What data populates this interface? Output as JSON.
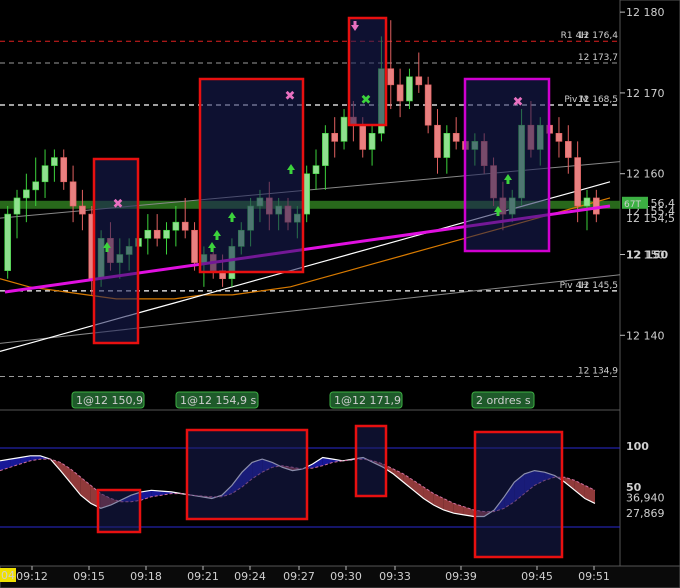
{
  "chart_data": [
    {
      "type": "candlestick",
      "price_axis": {
        "ticks": [
          "12 180",
          "12 170",
          "12 160",
          "12 150",
          "12 140"
        ],
        "range": [
          12131,
          12181.5
        ]
      },
      "time_axis": {
        "ticks": [
          "04",
          "09:12",
          "09:15",
          "09:18",
          "09:21",
          "09:24",
          "09:27",
          "09:30",
          "09:33",
          "09:39",
          "09:45",
          "09:51"
        ],
        "start_label": "04"
      },
      "levels": [
        {
          "name": "R1 4H",
          "label": "R1 4H",
          "value_label": "12 176,4",
          "value": 12176.4,
          "color": "#e02020",
          "style": "dashed"
        },
        {
          "name": "",
          "label": "",
          "value_label": "12 173,7",
          "value": 12173.7,
          "color": "#9a9a9a",
          "style": "dashed"
        },
        {
          "name": "Piv M",
          "label": "Piv M",
          "value_label": "12 168,5",
          "value": 12168.5,
          "color": "#ffffff",
          "style": "dashed"
        },
        {
          "name": "Piv 4H",
          "label": "Piv 4H",
          "value_label": "12 145,5",
          "value": 12145.5,
          "color": "#ffffff",
          "style": "dashed"
        },
        {
          "name": "",
          "label": "",
          "value_label": "12 134,9",
          "value": 12134.9,
          "color": "#9a9a9a",
          "style": "dashed"
        }
      ],
      "price_badges": [
        {
          "text": "12 156,4",
          "value": 12156.4,
          "color": "#3cb043"
        },
        {
          "text": "12 155,4",
          "value": 12155.4,
          "color": "#e05555"
        },
        {
          "text": "12 154,5",
          "value": 12154.5,
          "color": "#ffffff"
        },
        {
          "text": "12 150",
          "value": 12150.0,
          "color": "#ffffff"
        }
      ],
      "current_badge": "67T",
      "candles": [
        [
          12148,
          12156,
          12147,
          12155
        ],
        [
          12155,
          12158,
          12152,
          12157
        ],
        [
          12157,
          12160,
          12154,
          12158
        ],
        [
          12158,
          12162,
          12156,
          12159
        ],
        [
          12159,
          12163,
          12157,
          12161
        ],
        [
          12161,
          12163,
          12159,
          12162
        ],
        [
          12162,
          12163,
          12158,
          12159
        ],
        [
          12159,
          12161,
          12154,
          12156
        ],
        [
          12156,
          12158,
          12153,
          12155
        ],
        [
          12155,
          12156,
          12145,
          12147
        ],
        [
          12147,
          12153,
          12146,
          12152
        ],
        [
          12152,
          12154,
          12148,
          12149
        ],
        [
          12149,
          12152,
          12147,
          12150
        ],
        [
          12150,
          12152,
          12148,
          12151
        ],
        [
          12151,
          12153,
          12149,
          12152
        ],
        [
          12152,
          12155,
          12150,
          12153
        ],
        [
          12153,
          12155,
          12151,
          12152
        ],
        [
          12152,
          12154,
          12150,
          12153
        ],
        [
          12153,
          12156,
          12151,
          12154
        ],
        [
          12154,
          12157,
          12152,
          12153
        ],
        [
          12153,
          12154,
          12148,
          12149
        ],
        [
          12149,
          12151,
          12146,
          12150
        ],
        [
          12150,
          12151,
          12147,
          12148
        ],
        [
          12148,
          12150,
          12146,
          12147
        ],
        [
          12147,
          12152,
          12146,
          12151
        ],
        [
          12151,
          12154,
          12150,
          12153
        ],
        [
          12153,
          12157,
          12151,
          12156
        ],
        [
          12156,
          12158,
          12154,
          12157
        ],
        [
          12157,
          12159,
          12153,
          12155
        ],
        [
          12155,
          12157,
          12153,
          12156
        ],
        [
          12156,
          12157,
          12153,
          12154
        ],
        [
          12154,
          12156,
          12152,
          12155
        ],
        [
          12155,
          12161,
          12154,
          12160
        ],
        [
          12160,
          12163,
          12158,
          12161
        ],
        [
          12161,
          12166,
          12158,
          12165
        ],
        [
          12165,
          12167,
          12162,
          12164
        ],
        [
          12164,
          12168,
          12163,
          12167
        ],
        [
          12167,
          12169,
          12164,
          12166
        ],
        [
          12166,
          12167,
          12162,
          12163
        ],
        [
          12163,
          12166,
          12161,
          12165
        ],
        [
          12165,
          12177,
          12164,
          12173
        ],
        [
          12173,
          12179,
          12168,
          12171
        ],
        [
          12171,
          12173,
          12167,
          12169
        ],
        [
          12169,
          12173,
          12168,
          12172
        ],
        [
          12172,
          12175,
          12170,
          12171
        ],
        [
          12171,
          12172,
          12165,
          12166
        ],
        [
          12166,
          12168,
          12160,
          12162
        ],
        [
          12162,
          12166,
          12160,
          12165
        ],
        [
          12165,
          12167,
          12163,
          12164
        ],
        [
          12164,
          12165,
          12161,
          12163
        ],
        [
          12163,
          12165,
          12161,
          12164
        ],
        [
          12164,
          12165,
          12160,
          12161
        ],
        [
          12161,
          12162,
          12156,
          12157
        ],
        [
          12157,
          12159,
          12153,
          12155
        ],
        [
          12155,
          12158,
          12154,
          12157
        ],
        [
          12157,
          12168,
          12156,
          12166
        ],
        [
          12166,
          12169,
          12162,
          12163
        ],
        [
          12163,
          12167,
          12161,
          12166
        ],
        [
          12166,
          12168,
          12163,
          12165
        ],
        [
          12165,
          12167,
          12162,
          12164
        ],
        [
          12164,
          12166,
          12160,
          12162
        ],
        [
          12162,
          12164,
          12154,
          12156
        ],
        [
          12156,
          12158,
          12153,
          12157
        ],
        [
          12157,
          12158,
          12154,
          12155
        ]
      ],
      "lines": [
        {
          "color": "#d87a00",
          "values": [
            12147,
            12146,
            12145.5,
            12145,
            12144.5,
            12144.5,
            12144.5,
            12145,
            12145,
            12145.5,
            12146,
            12147,
            12148,
            12149,
            12150,
            12151,
            12152,
            12153,
            12154,
            12155,
            12156,
            12157
          ]
        },
        {
          "color": "#ffffff",
          "values": [
            12138,
            12139,
            12140,
            12141,
            12142,
            12143,
            12144,
            12145,
            12146,
            12147,
            12148,
            12149,
            12150,
            12151,
            12152,
            12153,
            12154,
            12155,
            12156,
            12157,
            12158,
            12159
          ]
        },
        {
          "color": "#e010e0",
          "values": [
            12142,
            12143,
            12144,
            12145,
            12146,
            12147,
            12148,
            12149,
            12150,
            12151,
            12152,
            12153,
            12154,
            12155,
            12156,
            12157,
            12158,
            12159,
            12160,
            12161,
            12162,
            12163
          ]
        }
      ],
      "trade_labels": [
        "1@12 150,9",
        "1@12 154,9",
        "1@12 171,9",
        "2 ordres"
      ],
      "trade_label_suffix": "s"
    },
    {
      "type": "area",
      "axis": {
        "ticks": [
          "100",
          "50"
        ]
      },
      "range": [
        0,
        100
      ],
      "value_badges": [
        {
          "text": "36,940",
          "value": 36.94,
          "color": "#e05555"
        },
        {
          "text": "27,869",
          "value": 27.869,
          "color": "#ffffff"
        }
      ],
      "fast": [
        82,
        84,
        86,
        88,
        88,
        84,
        70,
        55,
        40,
        30,
        24,
        28,
        34,
        40,
        44,
        46,
        45,
        44,
        42,
        40,
        38,
        36,
        40,
        52,
        68,
        80,
        84,
        80,
        74,
        70,
        72,
        78,
        86,
        84,
        82,
        84,
        86,
        80,
        74,
        66,
        56,
        46,
        36,
        28,
        22,
        18,
        16,
        14,
        14,
        22,
        38,
        56,
        66,
        70,
        68,
        64,
        56,
        46,
        36,
        30
      ],
      "slow": [
        70,
        74,
        78,
        82,
        84,
        84,
        80,
        72,
        62,
        52,
        42,
        36,
        32,
        32,
        34,
        38,
        40,
        42,
        42,
        40,
        39,
        38,
        38,
        42,
        50,
        60,
        68,
        74,
        76,
        74,
        72,
        73,
        76,
        80,
        82,
        83,
        84,
        82,
        78,
        72,
        66,
        58,
        50,
        42,
        36,
        30,
        26,
        22,
        20,
        20,
        24,
        32,
        42,
        52,
        58,
        62,
        62,
        58,
        52,
        46
      ]
    }
  ]
}
